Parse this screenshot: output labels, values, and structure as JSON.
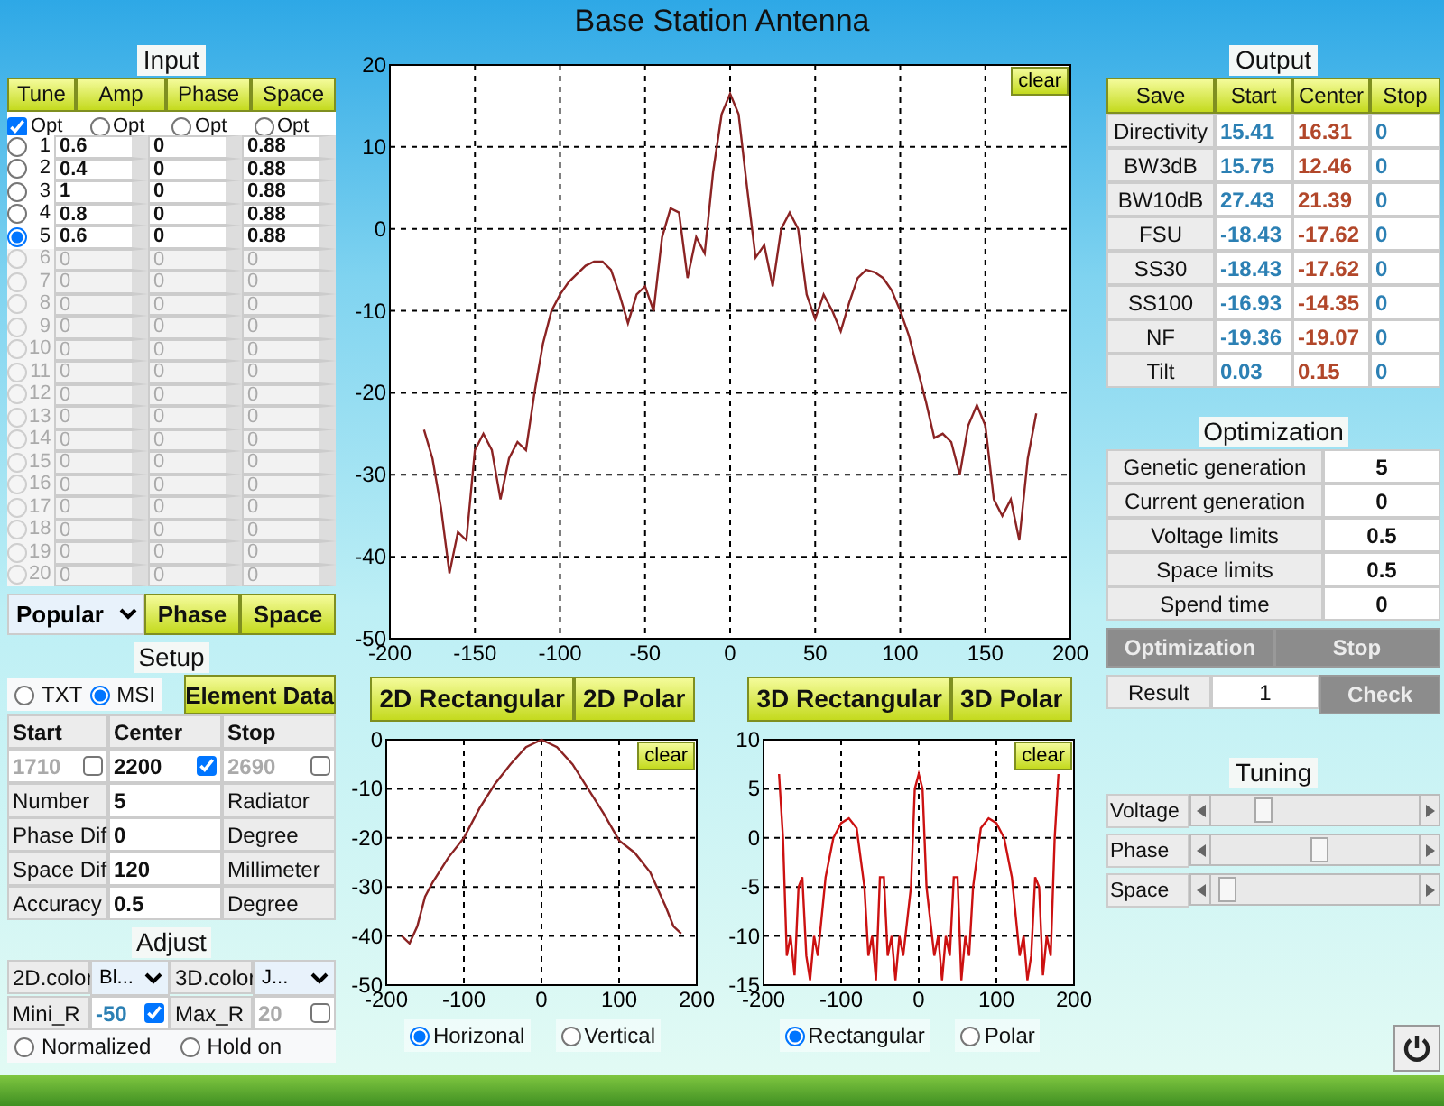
{
  "window": {
    "title": "Base Station Antenna"
  },
  "input": {
    "title": "Input",
    "buttons": [
      "Tune",
      "Amp",
      "Phase",
      "Space"
    ],
    "opt": [
      {
        "label": "Opt",
        "kind": "checkbox",
        "checked": true
      },
      {
        "label": "Opt",
        "kind": "radio",
        "checked": false
      },
      {
        "label": "Opt",
        "kind": "radio",
        "checked": false
      },
      {
        "label": "Opt",
        "kind": "radio",
        "checked": false
      }
    ],
    "rows": [
      {
        "index": "1",
        "amp": "0.6",
        "phase": "0",
        "space": "0.88",
        "selected": false,
        "disabled": false
      },
      {
        "index": "2",
        "amp": "0.4",
        "phase": "0",
        "space": "0.88",
        "selected": false,
        "disabled": false
      },
      {
        "index": "3",
        "amp": "1",
        "phase": "0",
        "space": "0.88",
        "selected": false,
        "disabled": false
      },
      {
        "index": "4",
        "amp": "0.8",
        "phase": "0",
        "space": "0.88",
        "selected": false,
        "disabled": false
      },
      {
        "index": "5",
        "amp": "0.6",
        "phase": "0",
        "space": "0.88",
        "selected": true,
        "disabled": false
      },
      {
        "index": "6",
        "amp": "0",
        "phase": "0",
        "space": "0",
        "selected": false,
        "disabled": true
      },
      {
        "index": "7",
        "amp": "0",
        "phase": "0",
        "space": "0",
        "selected": false,
        "disabled": true
      },
      {
        "index": "8",
        "amp": "0",
        "phase": "0",
        "space": "0",
        "selected": false,
        "disabled": true
      },
      {
        "index": "9",
        "amp": "0",
        "phase": "0",
        "space": "0",
        "selected": false,
        "disabled": true
      },
      {
        "index": "10",
        "amp": "0",
        "phase": "0",
        "space": "0",
        "selected": false,
        "disabled": true
      },
      {
        "index": "11",
        "amp": "0",
        "phase": "0",
        "space": "0",
        "selected": false,
        "disabled": true
      },
      {
        "index": "12",
        "amp": "0",
        "phase": "0",
        "space": "0",
        "selected": false,
        "disabled": true
      },
      {
        "index": "13",
        "amp": "0",
        "phase": "0",
        "space": "0",
        "selected": false,
        "disabled": true
      },
      {
        "index": "14",
        "amp": "0",
        "phase": "0",
        "space": "0",
        "selected": false,
        "disabled": true
      },
      {
        "index": "15",
        "amp": "0",
        "phase": "0",
        "space": "0",
        "selected": false,
        "disabled": true
      },
      {
        "index": "16",
        "amp": "0",
        "phase": "0",
        "space": "0",
        "selected": false,
        "disabled": true
      },
      {
        "index": "17",
        "amp": "0",
        "phase": "0",
        "space": "0",
        "selected": false,
        "disabled": true
      },
      {
        "index": "18",
        "amp": "0",
        "phase": "0",
        "space": "0",
        "selected": false,
        "disabled": true
      },
      {
        "index": "19",
        "amp": "0",
        "phase": "0",
        "space": "0",
        "selected": false,
        "disabled": true
      },
      {
        "index": "20",
        "amp": "0",
        "phase": "0",
        "space": "0",
        "selected": false,
        "disabled": true
      }
    ],
    "preset": "Popular",
    "bottom_buttons": [
      "Phase",
      "Space"
    ]
  },
  "setup": {
    "title": "Setup",
    "format": [
      {
        "label": "TXT",
        "selected": false
      },
      {
        "label": "MSI",
        "selected": true
      }
    ],
    "element_button": "Element Data",
    "freq_header": [
      "Start",
      "Center",
      "Stop"
    ],
    "freq": [
      {
        "value": "1710",
        "checked": false
      },
      {
        "value": "2200",
        "checked": true
      },
      {
        "value": "2690",
        "checked": false
      }
    ],
    "params": [
      {
        "label": "Number",
        "value": "5",
        "unit": "Radiator"
      },
      {
        "label": "Phase Dif",
        "value": "0",
        "unit": "Degree"
      },
      {
        "label": "Space Dif",
        "value": "120",
        "unit": "Millimeter"
      },
      {
        "label": "Accuracy",
        "value": "0.5",
        "unit": "Degree"
      }
    ]
  },
  "adjust": {
    "title": "Adjust",
    "colors": [
      {
        "label": "2D.color",
        "value": "Bl..."
      },
      {
        "label": "3D.color",
        "value": "J..."
      }
    ],
    "ranges": [
      {
        "label": "Mini_R",
        "value": "-50",
        "checked": true
      },
      {
        "label": "Max_R",
        "value": "20",
        "checked": false
      }
    ],
    "modes": [
      {
        "label": "Normalized",
        "selected": false
      },
      {
        "label": "Hold on",
        "selected": false
      }
    ]
  },
  "main_chart": {
    "clear": "clear",
    "chart_data": {
      "type": "line",
      "xlim": [
        -200,
        200
      ],
      "ylim": [
        -50,
        20
      ],
      "xticks": [
        -200,
        -150,
        -100,
        -50,
        0,
        50,
        100,
        150,
        200
      ],
      "yticks": [
        -50,
        -40,
        -30,
        -20,
        -10,
        0,
        10,
        20
      ],
      "x": [
        -180,
        -175,
        -170,
        -165,
        -160,
        -155,
        -150,
        -145,
        -140,
        -135,
        -130,
        -125,
        -120,
        -115,
        -110,
        -105,
        -100,
        -95,
        -90,
        -85,
        -80,
        -75,
        -70,
        -65,
        -60,
        -55,
        -50,
        -45,
        -40,
        -35,
        -30,
        -25,
        -20,
        -15,
        -10,
        -5,
        0,
        5,
        10,
        15,
        20,
        25,
        30,
        35,
        40,
        45,
        50,
        55,
        60,
        65,
        70,
        75,
        80,
        85,
        90,
        95,
        100,
        105,
        110,
        115,
        120,
        125,
        130,
        135,
        140,
        145,
        150,
        155,
        160,
        165,
        170,
        175,
        180
      ],
      "grid": true,
      "series": [
        {
          "color": "#8b2323",
          "values": [
            -24.5,
            -28,
            -34,
            -42,
            -37,
            -38,
            -27,
            -25,
            -27,
            -33,
            -28,
            -26,
            -27,
            -20,
            -14,
            -10,
            -8,
            -6.5,
            -5.5,
            -4.5,
            -4,
            -4,
            -5,
            -8,
            -11.5,
            -8,
            -7,
            -10,
            -1,
            2.5,
            2,
            -6,
            -1,
            -3,
            7,
            14,
            16.5,
            14,
            5,
            -3.5,
            -2,
            -7,
            0,
            2,
            0,
            -8,
            -11,
            -8,
            -10,
            -12.5,
            -9,
            -6,
            -5,
            -5.3,
            -6,
            -7.5,
            -10,
            -13,
            -17,
            -21,
            -25.5,
            -25,
            -26,
            -30,
            -24,
            -21.5,
            -24,
            -33,
            -35,
            -33,
            -38,
            -28,
            -22.5
          ]
        }
      ]
    }
  },
  "views": [
    {
      "buttons": [
        "2D Rectangular",
        "2D Polar"
      ],
      "clear": "clear",
      "chart_data": {
        "type": "line",
        "xlim": [
          -200,
          200
        ],
        "ylim": [
          -50,
          0
        ],
        "xticks": [
          -200,
          -100,
          0,
          100,
          200
        ],
        "yticks": [
          -50,
          -40,
          -30,
          -20,
          -10,
          0
        ],
        "x": [
          -180,
          -170,
          -160,
          -150,
          -140,
          -120,
          -100,
          -80,
          -60,
          -40,
          -20,
          0,
          20,
          40,
          60,
          80,
          100,
          120,
          140,
          160,
          170,
          180
        ],
        "grid": true,
        "series": [
          {
            "color": "#8b2323",
            "values": [
              -40,
              -41.5,
              -38,
              -32,
              -29,
              -24,
              -20,
              -14,
              -9,
              -5,
              -1.5,
              0,
              -1.5,
              -5,
              -10,
              -15,
              -20.5,
              -23,
              -27,
              -34,
              -38,
              -39.5
            ]
          }
        ]
      },
      "options": [
        {
          "label": "Horizonal",
          "selected": true
        },
        {
          "label": "Vertical",
          "selected": false
        }
      ]
    },
    {
      "buttons": [
        "3D Rectangular",
        "3D Polar"
      ],
      "clear": "clear",
      "chart_data": {
        "type": "line",
        "xlim": [
          -200,
          200
        ],
        "ylim": [
          -15,
          10
        ],
        "xticks": [
          -200,
          -100,
          0,
          100,
          200
        ],
        "yticks": [
          -15,
          -10,
          -5,
          0,
          5,
          10
        ],
        "x": [
          -180,
          -175,
          -170,
          -165,
          -160,
          -155,
          -150,
          -145,
          -140,
          -135,
          -130,
          -120,
          -110,
          -100,
          -90,
          -80,
          -70,
          -65,
          -60,
          -55,
          -50,
          -45,
          -40,
          -35,
          -30,
          -25,
          -20,
          -10,
          -5,
          0,
          5,
          10,
          20,
          25,
          30,
          35,
          40,
          45,
          50,
          55,
          60,
          65,
          70,
          80,
          90,
          100,
          110,
          120,
          130,
          135,
          140,
          145,
          150,
          155,
          160,
          165,
          170,
          175,
          180
        ],
        "grid": true,
        "series": [
          {
            "color": "#cc1111",
            "values": [
              6.5,
              0,
              -12,
              -10,
              -14,
              -5,
              -4,
              -12,
              -14.5,
              -10,
              -12,
              -4,
              0,
              1.5,
              2,
              1,
              -5,
              -12,
              -10,
              -14.5,
              -4,
              -4,
              -12,
              -10,
              -14.5,
              -10,
              -12,
              -5,
              5,
              6.5,
              5,
              -5,
              -12,
              -10,
              -14.5,
              -10,
              -12,
              -4,
              -4,
              -14.5,
              -10,
              -12,
              -5,
              1,
              2,
              1.5,
              0,
              -4,
              -12,
              -10,
              -14.5,
              -12,
              -4,
              -5,
              -14,
              -10,
              -12,
              0,
              6.5
            ]
          }
        ]
      },
      "options": [
        {
          "label": "Rectangular",
          "selected": true
        },
        {
          "label": "Polar",
          "selected": false
        }
      ]
    }
  ],
  "output": {
    "title": "Output",
    "columns": [
      "Save",
      "Start",
      "Center",
      "Stop"
    ],
    "rows": [
      {
        "label": "Directivity",
        "start": "15.41",
        "center": "16.31",
        "stop": "0"
      },
      {
        "label": "BW3dB",
        "start": "15.75",
        "center": "12.46",
        "stop": "0"
      },
      {
        "label": "BW10dB",
        "start": "27.43",
        "center": "21.39",
        "stop": "0"
      },
      {
        "label": "FSU",
        "start": "-18.43",
        "center": "-17.62",
        "stop": "0"
      },
      {
        "label": "SS30",
        "start": "-18.43",
        "center": "-17.62",
        "stop": "0"
      },
      {
        "label": "SS100",
        "start": "-16.93",
        "center": "-14.35",
        "stop": "0"
      },
      {
        "label": "NF",
        "start": "-19.36",
        "center": "-19.07",
        "stop": "0"
      },
      {
        "label": "Tilt",
        "start": "0.03",
        "center": "0.15",
        "stop": "0"
      }
    ]
  },
  "optimization": {
    "title": "Optimization",
    "rows": [
      {
        "label": "Genetic generation",
        "value": "5"
      },
      {
        "label": "Current generation",
        "value": "0"
      },
      {
        "label": "Voltage limits",
        "value": "0.5"
      },
      {
        "label": "Space limits",
        "value": "0.5"
      },
      {
        "label": "Spend time",
        "value": "0"
      }
    ],
    "buttons": [
      {
        "label": "Optimization",
        "disabled": true
      },
      {
        "label": "Stop",
        "disabled": true
      }
    ],
    "result_label": "Result",
    "result": "1",
    "check": {
      "label": "Check",
      "disabled": true
    }
  },
  "tuning": {
    "title": "Tuning",
    "sliders": [
      {
        "label": "Voltage",
        "level": 0.23
      },
      {
        "label": "Phase",
        "level": 0.52
      },
      {
        "label": "Space",
        "level": 0.04
      }
    ]
  }
}
